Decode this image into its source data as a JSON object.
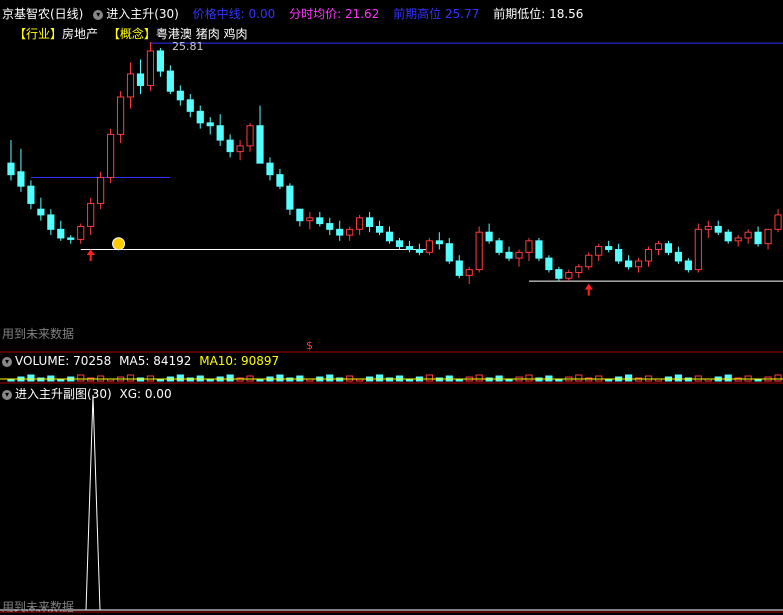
{
  "header": {
    "stock_name": "京基智农(日线)",
    "indicator_name": "进入主升(30)",
    "label_mid": "价格中线:",
    "value_mid": "0.00",
    "label_avg": "分时均价:",
    "value_avg": "21.62",
    "label_high": "前期高位",
    "value_high": "25.77",
    "label_low": "前期低位:",
    "value_low": "18.56"
  },
  "tags": {
    "industry_tag": "【行业】",
    "industry": "房地产",
    "concept_tag": "【概念】",
    "concept": "粤港澳 猪肉 鸡肉"
  },
  "main_chart": {
    "peak_label": "25.81",
    "future_data_text": "用到未来数据",
    "dollar_marker": "$",
    "colors": {
      "up": "#ff3c3c",
      "down": "#54ffff",
      "high_line": "#3030ff",
      "support": "#ffffff",
      "ma": "#ffff00"
    }
  },
  "volume_panel": {
    "label": "VOLUME:",
    "value": "70258",
    "ma5_label": "MA5:",
    "ma5": "84192",
    "ma10_label": "MA10:",
    "ma10": "90897"
  },
  "sub_panel": {
    "title": "进入主升副图(30)",
    "xg_label": "XG:",
    "xg_value": "0.00",
    "future_data_text": "用到未来数据"
  },
  "chart_data": {
    "type": "candlestick",
    "ohlc": [
      [
        21.6,
        22.4,
        21.0,
        21.2
      ],
      [
        21.3,
        22.1,
        20.6,
        20.8
      ],
      [
        20.8,
        21.0,
        20.0,
        20.2
      ],
      [
        20.0,
        20.4,
        19.6,
        19.8
      ],
      [
        19.8,
        20.0,
        19.1,
        19.3
      ],
      [
        19.3,
        19.6,
        18.9,
        19.0
      ],
      [
        19.0,
        19.1,
        18.8,
        18.95
      ],
      [
        18.95,
        19.5,
        18.8,
        19.4
      ],
      [
        19.4,
        20.4,
        19.1,
        20.2
      ],
      [
        20.2,
        21.3,
        20.0,
        21.1
      ],
      [
        21.1,
        22.8,
        20.9,
        22.6
      ],
      [
        22.6,
        24.1,
        22.3,
        23.9
      ],
      [
        23.9,
        25.1,
        23.5,
        24.7
      ],
      [
        24.7,
        25.2,
        24.0,
        24.3
      ],
      [
        24.3,
        25.81,
        24.1,
        25.5
      ],
      [
        25.5,
        25.6,
        24.6,
        24.8
      ],
      [
        24.8,
        25.0,
        24.0,
        24.1
      ],
      [
        24.1,
        24.3,
        23.6,
        23.8
      ],
      [
        23.8,
        24.0,
        23.2,
        23.4
      ],
      [
        23.4,
        23.6,
        22.8,
        23.0
      ],
      [
        23.0,
        23.2,
        22.6,
        22.9
      ],
      [
        22.9,
        23.3,
        22.2,
        22.4
      ],
      [
        22.4,
        22.6,
        21.8,
        22.0
      ],
      [
        22.0,
        22.4,
        21.7,
        22.2
      ],
      [
        22.2,
        23.0,
        22.0,
        22.9
      ],
      [
        22.9,
        23.6,
        22.6,
        21.6
      ],
      [
        21.6,
        21.8,
        21.0,
        21.2
      ],
      [
        21.2,
        21.4,
        20.7,
        20.8
      ],
      [
        20.8,
        20.9,
        19.8,
        20.0
      ],
      [
        20.0,
        19.9,
        19.4,
        19.6
      ],
      [
        19.6,
        19.9,
        19.3,
        19.7
      ],
      [
        19.7,
        19.9,
        19.4,
        19.5
      ],
      [
        19.5,
        19.7,
        19.1,
        19.3
      ],
      [
        19.3,
        19.6,
        18.9,
        19.1
      ],
      [
        19.1,
        19.4,
        18.9,
        19.3
      ],
      [
        19.3,
        19.8,
        19.1,
        19.7
      ],
      [
        19.7,
        19.9,
        19.2,
        19.4
      ],
      [
        19.4,
        19.6,
        19.1,
        19.2
      ],
      [
        19.2,
        19.4,
        18.8,
        18.9
      ],
      [
        18.9,
        19.0,
        18.6,
        18.7
      ],
      [
        18.7,
        18.9,
        18.5,
        18.6
      ],
      [
        18.6,
        18.8,
        18.4,
        18.5
      ],
      [
        18.5,
        19.0,
        18.4,
        18.9
      ],
      [
        18.9,
        19.2,
        18.6,
        18.8
      ],
      [
        18.8,
        19.0,
        18.1,
        18.2
      ],
      [
        18.2,
        18.4,
        17.6,
        17.7
      ],
      [
        17.7,
        18.0,
        17.4,
        17.9
      ],
      [
        17.9,
        19.4,
        17.8,
        19.2
      ],
      [
        19.2,
        19.5,
        18.8,
        18.9
      ],
      [
        18.9,
        19.0,
        18.4,
        18.5
      ],
      [
        18.5,
        18.7,
        18.2,
        18.3
      ],
      [
        18.3,
        18.6,
        18.0,
        18.5
      ],
      [
        18.5,
        19.0,
        18.2,
        18.9
      ],
      [
        18.9,
        19.0,
        18.2,
        18.3
      ],
      [
        18.3,
        18.4,
        17.8,
        17.9
      ],
      [
        17.9,
        18.0,
        17.5,
        17.6
      ],
      [
        17.6,
        17.9,
        17.5,
        17.8
      ],
      [
        17.8,
        18.1,
        17.6,
        18.0
      ],
      [
        18.0,
        18.5,
        17.9,
        18.4
      ],
      [
        18.4,
        18.8,
        18.2,
        18.7
      ],
      [
        18.7,
        18.9,
        18.5,
        18.6
      ],
      [
        18.6,
        18.8,
        18.1,
        18.2
      ],
      [
        18.2,
        18.4,
        17.9,
        18.0
      ],
      [
        18.0,
        18.3,
        17.8,
        18.2
      ],
      [
        18.2,
        18.7,
        18.0,
        18.6
      ],
      [
        18.6,
        18.9,
        18.4,
        18.8
      ],
      [
        18.8,
        18.9,
        18.4,
        18.5
      ],
      [
        18.5,
        18.7,
        18.1,
        18.2
      ],
      [
        18.2,
        18.3,
        17.8,
        17.9
      ],
      [
        17.9,
        19.5,
        17.8,
        19.3
      ],
      [
        19.3,
        19.6,
        19.0,
        19.4
      ],
      [
        19.4,
        19.6,
        19.1,
        19.2
      ],
      [
        19.2,
        19.3,
        18.8,
        18.9
      ],
      [
        18.9,
        19.1,
        18.7,
        19.0
      ],
      [
        19.0,
        19.3,
        18.8,
        19.2
      ],
      [
        19.2,
        19.4,
        18.7,
        18.8
      ],
      [
        18.8,
        19.0,
        18.6,
        19.3
      ],
      [
        19.3,
        20.0,
        19.2,
        19.8
      ]
    ],
    "prior_high": 25.77,
    "prior_low": 18.56,
    "peak": 25.81,
    "volume": {
      "MA5": 84192,
      "MA10": 90897,
      "last": 70258
    },
    "xg_signal_value": 0.0,
    "signal_arrows": [
      8,
      58
    ]
  }
}
